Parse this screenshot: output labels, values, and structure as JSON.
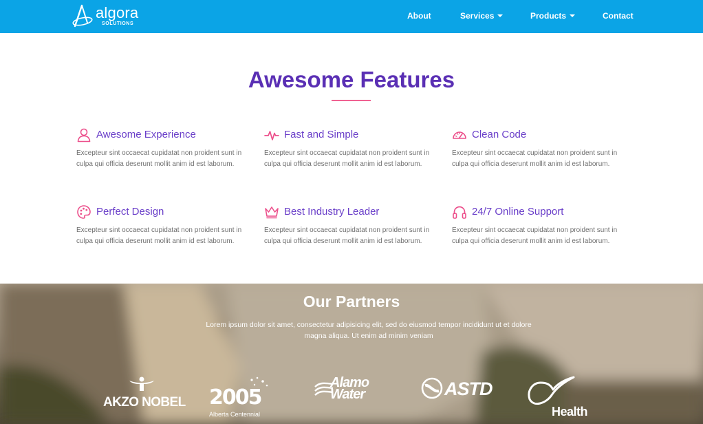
{
  "navbar": {
    "brand": {
      "name": "algora",
      "tagline": "SOLUTIONS"
    },
    "items": [
      {
        "label": "About"
      },
      {
        "label": "Services",
        "dropdown": true
      },
      {
        "label": "Products",
        "dropdown": true
      },
      {
        "label": "Contact"
      }
    ]
  },
  "features": {
    "title": "Awesome Features",
    "items": [
      {
        "icon": "user-icon",
        "title": "Awesome Experience",
        "text": "Excepteur sint occaecat cupidatat non proident sunt in culpa qui officia deserunt mollit anim id est laborum."
      },
      {
        "icon": "pulse-icon",
        "title": "Fast and Simple",
        "text": "Excepteur sint occaecat cupidatat non proident sunt in culpa qui officia deserunt mollit anim id est laborum."
      },
      {
        "icon": "speedometer-icon",
        "title": "Clean Code",
        "text": "Excepteur sint occaecat cupidatat non proident sunt in culpa qui officia deserunt mollit anim id est laborum."
      },
      {
        "icon": "palette-icon",
        "title": "Perfect Design",
        "text": "Excepteur sint occaecat cupidatat non proident sunt in culpa qui officia deserunt mollit anim id est laborum."
      },
      {
        "icon": "crown-icon",
        "title": "Best Industry Leader",
        "text": "Excepteur sint occaecat cupidatat non proident sunt in culpa qui officia deserunt mollit anim id est laborum."
      },
      {
        "icon": "headphones-icon",
        "title": "24/7 Online Support",
        "text": "Excepteur sint occaecat cupidatat non proident sunt in culpa qui officia deserunt mollit anim id est laborum."
      }
    ]
  },
  "partners": {
    "title": "Our Partners",
    "text": "Lorem ipsum dolor sit amet, consectetur adipisicing elit, sed do eiusmod tempor incididunt ut et dolore magna aliqua. Ut enim ad minim veniam",
    "logos": [
      {
        "name": "AKZO NOBEL"
      },
      {
        "name": "2005",
        "caption": "Alberta Centennial"
      },
      {
        "name": "Alamo Water"
      },
      {
        "name": "ASTD"
      },
      {
        "name": "Health"
      }
    ]
  },
  "colors": {
    "navbar": "#0ba4e6",
    "heading": "#5a2fb4",
    "feature_title": "#6a3fc9",
    "icon_accent": "#ec4f8b",
    "rule": "#f06292",
    "body_text": "#6f6f6f"
  }
}
